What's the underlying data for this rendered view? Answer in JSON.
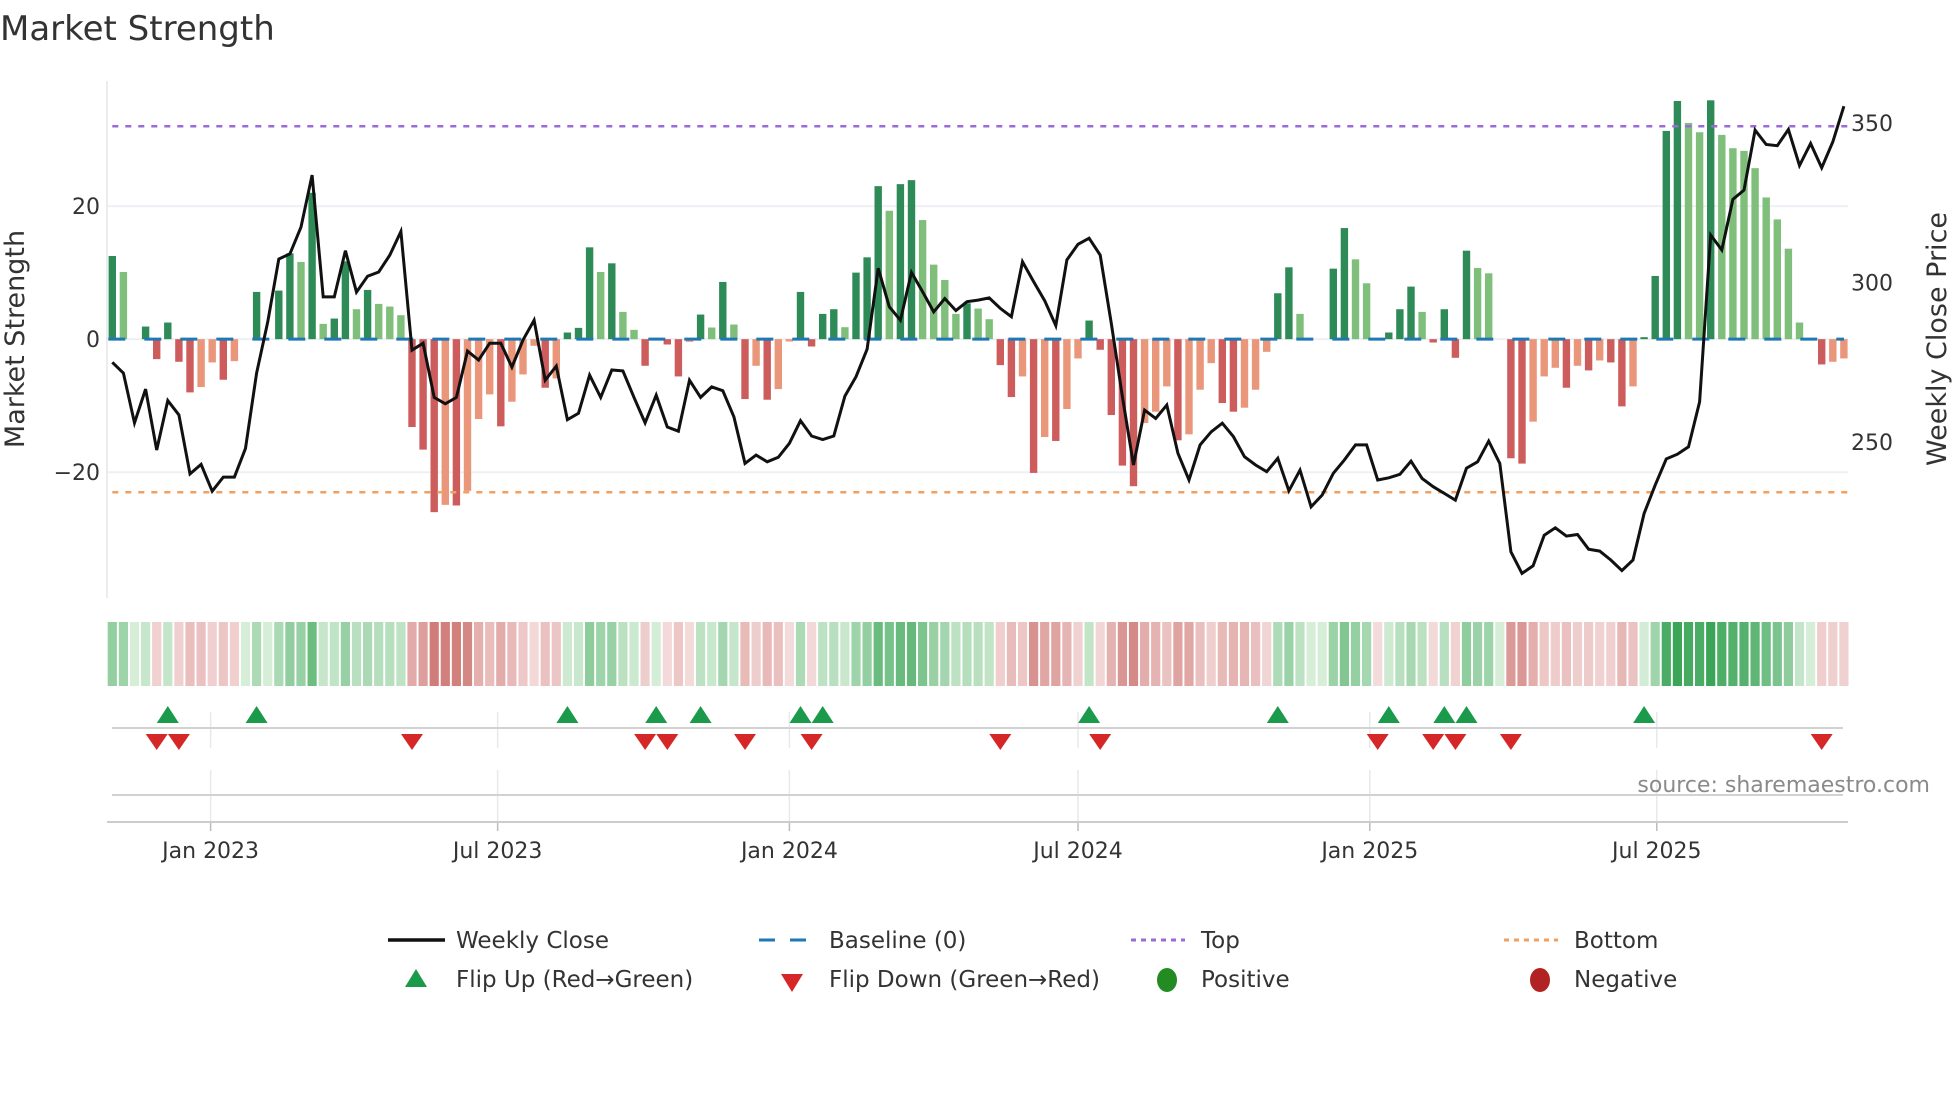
{
  "chart_data": {
    "type": "bar+line",
    "title": "Market Strength",
    "ylabel": "Market Strength",
    "y2label": "Weekly Close Price",
    "ylim": [
      -38.9,
      38.8
    ],
    "y2lim": [
      201.1,
      363.2
    ],
    "yticks": [
      {
        "value": -20,
        "label": "−20"
      },
      {
        "value": 0,
        "label": "0"
      },
      {
        "value": 20,
        "label": "20"
      }
    ],
    "y2ticks": [
      {
        "value": 250,
        "label": "250"
      },
      {
        "value": 300,
        "label": "300"
      },
      {
        "value": 350,
        "label": "350"
      }
    ],
    "xticks": [
      {
        "date": "2023-01-01",
        "label": "Jan 2023"
      },
      {
        "date": "2023-07-01",
        "label": "Jul 2023"
      },
      {
        "date": "2024-01-01",
        "label": "Jan 2024"
      },
      {
        "date": "2024-07-01",
        "label": "Jul 2024"
      },
      {
        "date": "2025-01-01",
        "label": "Jan 2025"
      },
      {
        "date": "2025-07-01",
        "label": "Jul 2025"
      }
    ],
    "x_start": "2022-10-31",
    "x_frequency": "weekly",
    "grid": true,
    "top_level": 32,
    "bottom_level": -23,
    "baseline": 0,
    "strength": [
      12.5,
      10.1,
      0,
      1.9,
      -3.0,
      2.5,
      -3.4,
      -8.0,
      -7.2,
      -3.5,
      -6.1,
      -3.3,
      0,
      7.1,
      0,
      7.3,
      12.9,
      11.6,
      22,
      2.3,
      3.1,
      11.7,
      4.5,
      7.4,
      5.3,
      4.9,
      3.6,
      -13.2,
      -16.6,
      -26,
      -24.9,
      -25,
      -22.8,
      -12,
      -8.3,
      -13.1,
      -9.4,
      -5.3,
      -1,
      -7.3,
      -5.9,
      1,
      1.7,
      13.8,
      10.1,
      11.4,
      4.1,
      1.4,
      -4.0,
      0.2,
      -0.8,
      -5.6,
      -0.4,
      3.7,
      1.75,
      8.6,
      2.2,
      -9.0,
      -4.0,
      -9.1,
      -7.5,
      -0.35,
      7.1,
      -1.1,
      3.8,
      4.5,
      1.8,
      10,
      12.3,
      23,
      19.3,
      23.3,
      23.9,
      17.9,
      11.2,
      8.9,
      3.8,
      5.4,
      4.6,
      3.0,
      -3.9,
      -8.7,
      -5.6,
      -20.1,
      -14.7,
      -15.3,
      -10.5,
      -2.9,
      2.8,
      -1.6,
      -11.4,
      -19,
      -22.1,
      -12.6,
      -10.9,
      -7.1,
      -15.2,
      -14.3,
      -7.6,
      -3.6,
      -9.6,
      -10.9,
      -10.3,
      -7.6,
      -1.9,
      6.9,
      10.8,
      3.8,
      0,
      0,
      10.6,
      16.7,
      12,
      8.4,
      -0.2,
      1.0,
      4.5,
      7.9,
      4.1,
      -0.5,
      4.5,
      -2.8,
      13.3,
      10.7,
      9.9,
      0,
      -17.9,
      -18.7,
      -12.4,
      -5.6,
      -4.3,
      -7.3,
      -4.0,
      -4.7,
      -3.2,
      -3.5,
      -10.1,
      -7.1,
      0.3,
      9.5,
      31.3,
      35.8,
      32.5,
      31.1,
      35.9,
      30.7,
      28.7,
      28.3,
      25.7,
      21.3,
      18,
      13.6,
      2.5,
      0,
      -3.8,
      -3.4,
      -2.9
    ],
    "weekly_close": [
      275,
      271.6,
      256,
      266.6,
      247.5,
      263,
      258.5,
      240,
      243,
      234.6,
      239,
      239,
      248,
      271.6,
      287.6,
      307.4,
      309,
      317.4,
      333.7,
      295.5,
      295.5,
      310,
      297,
      302,
      303.3,
      308.6,
      316,
      278.8,
      281,
      264,
      262,
      264,
      278.5,
      275.7,
      281,
      281,
      273.5,
      282,
      288.2,
      269.4,
      273.8,
      257,
      259,
      271,
      264,
      272.6,
      272.3,
      264,
      256,
      264.7,
      254.7,
      253.4,
      269.4,
      264,
      267.3,
      266.1,
      257.9,
      243.3,
      245.9,
      243.8,
      245.2,
      249.6,
      256.7,
      251.9,
      250.8,
      251.9,
      264.4,
      270.5,
      279.1,
      304.5,
      292.4,
      288.2,
      303.2,
      297.1,
      290.8,
      295,
      291.2,
      294,
      294.5,
      295.2,
      291.9,
      289.3,
      306.5,
      300.3,
      294.3,
      286.5,
      307.1,
      312,
      313.9,
      308.6,
      287.2,
      264.2,
      242.8,
      260,
      257.4,
      261.6,
      246.5,
      238.1,
      249.1,
      253.2,
      255.9,
      251.7,
      245.4,
      242.8,
      240.7,
      244.9,
      234.7,
      241.2,
      229.7,
      233.4,
      240.2,
      244.4,
      249.1,
      249.1,
      238.1,
      238.8,
      239.9,
      244.0,
      238.6,
      236.0,
      233.9,
      231.8,
      241.8,
      243.8,
      250.3,
      243.3,
      215.6,
      208.8,
      211.2,
      220.8,
      223.1,
      220.5,
      221.0,
      216.4,
      215.8,
      213.0,
      209.7,
      213.0,
      227.6,
      236.5,
      244.7,
      246.2,
      248.5,
      262.6,
      314.9,
      310.2,
      326.1,
      329,
      347.8,
      343.3,
      342.9,
      348,
      336.7,
      343.6,
      336,
      344.1,
      355.3
    ],
    "flip_up_index": [
      5,
      13,
      41,
      49,
      53,
      62,
      64,
      88,
      105,
      115,
      120,
      122,
      138
    ],
    "flip_down_index": [
      4,
      6,
      27,
      48,
      50,
      57,
      63,
      80,
      89,
      114,
      119,
      121,
      126,
      154
    ],
    "legend": [
      {
        "label": "Weekly Close",
        "symbol": "line"
      },
      {
        "label": "Baseline (0)",
        "symbol": "dash"
      },
      {
        "label": "Top",
        "symbol": "dot"
      },
      {
        "label": "Bottom",
        "symbol": "dot"
      },
      {
        "label": "Flip Up (Red→Green)",
        "symbol": "triangle-up"
      },
      {
        "label": "Flip Down (Green→Red)",
        "symbol": "triangle-down"
      },
      {
        "label": "Positive",
        "symbol": "circle"
      },
      {
        "label": "Negative",
        "symbol": "circle"
      }
    ],
    "legend_position": "bottom",
    "source": "source: sharemaestro.com",
    "colors": {
      "positive_rising": "#2e8b57",
      "positive_falling": "#7fbf7b",
      "negative_falling": "#cd5c5c",
      "negative_rising": "#e9967a",
      "close_line": "#111111",
      "baseline": "#1f77b4",
      "top": "#9b6bd6",
      "bottom": "#f0a060",
      "flip_up": "#1a9a4a",
      "flip_down": "#d62728",
      "positive_dot": "#228b22",
      "negative_dot": "#b22222"
    }
  }
}
